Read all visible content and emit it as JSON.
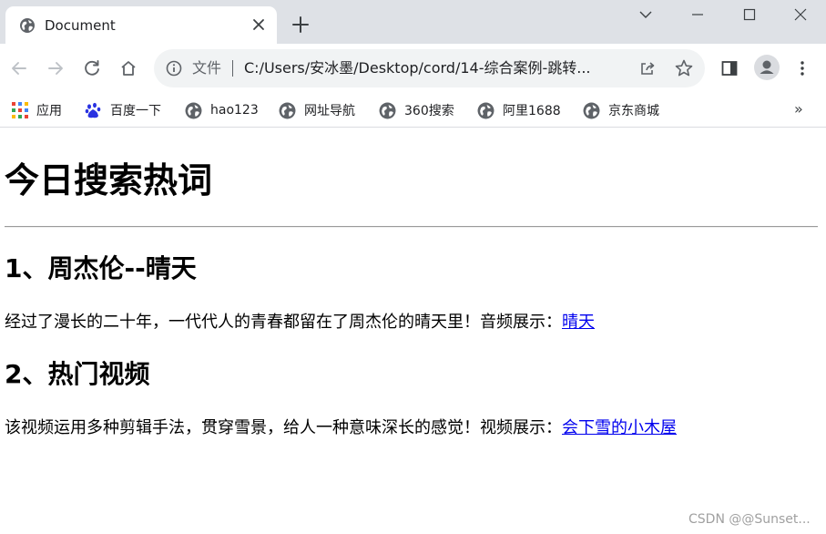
{
  "browser": {
    "tab": {
      "title": "Document",
      "favicon": "globe-icon",
      "close_icon": "close-icon"
    },
    "new_tab_icon": "plus-icon",
    "window_controls": [
      "chevron-down-icon",
      "minimize-icon",
      "maximize-icon",
      "close-icon"
    ],
    "toolbar": {
      "back_icon": "arrow-left-icon",
      "forward_icon": "arrow-right-icon",
      "reload_icon": "reload-icon",
      "home_icon": "home-icon",
      "address": {
        "scheme_label": "文件",
        "url": "C:/Users/安冰墨/Desktop/cord/14-综合案例-跳转..."
      },
      "share_icon": "share-icon",
      "bookmark_star_icon": "star-icon",
      "sidepanel_icon": "side-panel-icon",
      "profile_icon": "profile-icon",
      "menu_icon": "kebab-menu-icon"
    },
    "bookmarks": [
      {
        "label": "应用",
        "icon": "apps-grid-icon"
      },
      {
        "label": "百度一下",
        "icon": "baidu-paw-icon"
      },
      {
        "label": "hao123",
        "icon": "globe-icon"
      },
      {
        "label": "网址导航",
        "icon": "globe-icon"
      },
      {
        "label": "360搜索",
        "icon": "globe-icon"
      },
      {
        "label": "阿里1688",
        "icon": "globe-icon"
      },
      {
        "label": "京东商城",
        "icon": "globe-icon"
      }
    ],
    "bookmarks_more": "»"
  },
  "page": {
    "title": "今日搜索热词",
    "sections": [
      {
        "heading": "1、周杰伦--晴天",
        "text": "经过了漫长的二十年，一代代人的青春都留在了周杰伦的晴天里！音频展示：",
        "link": "晴天"
      },
      {
        "heading": "2、热门视频",
        "text": "该视频运用多种剪辑手法，贯穿雪景，给人一种意味深长的感觉！视频展示：",
        "link": "会下雪的小木屋"
      }
    ],
    "watermark": "CSDN @@Sunset..."
  },
  "colors": {
    "tabstrip": "#dee1e6",
    "omnibox": "#f1f3f4",
    "link": "#0000ee",
    "icon": "#5f6368"
  }
}
